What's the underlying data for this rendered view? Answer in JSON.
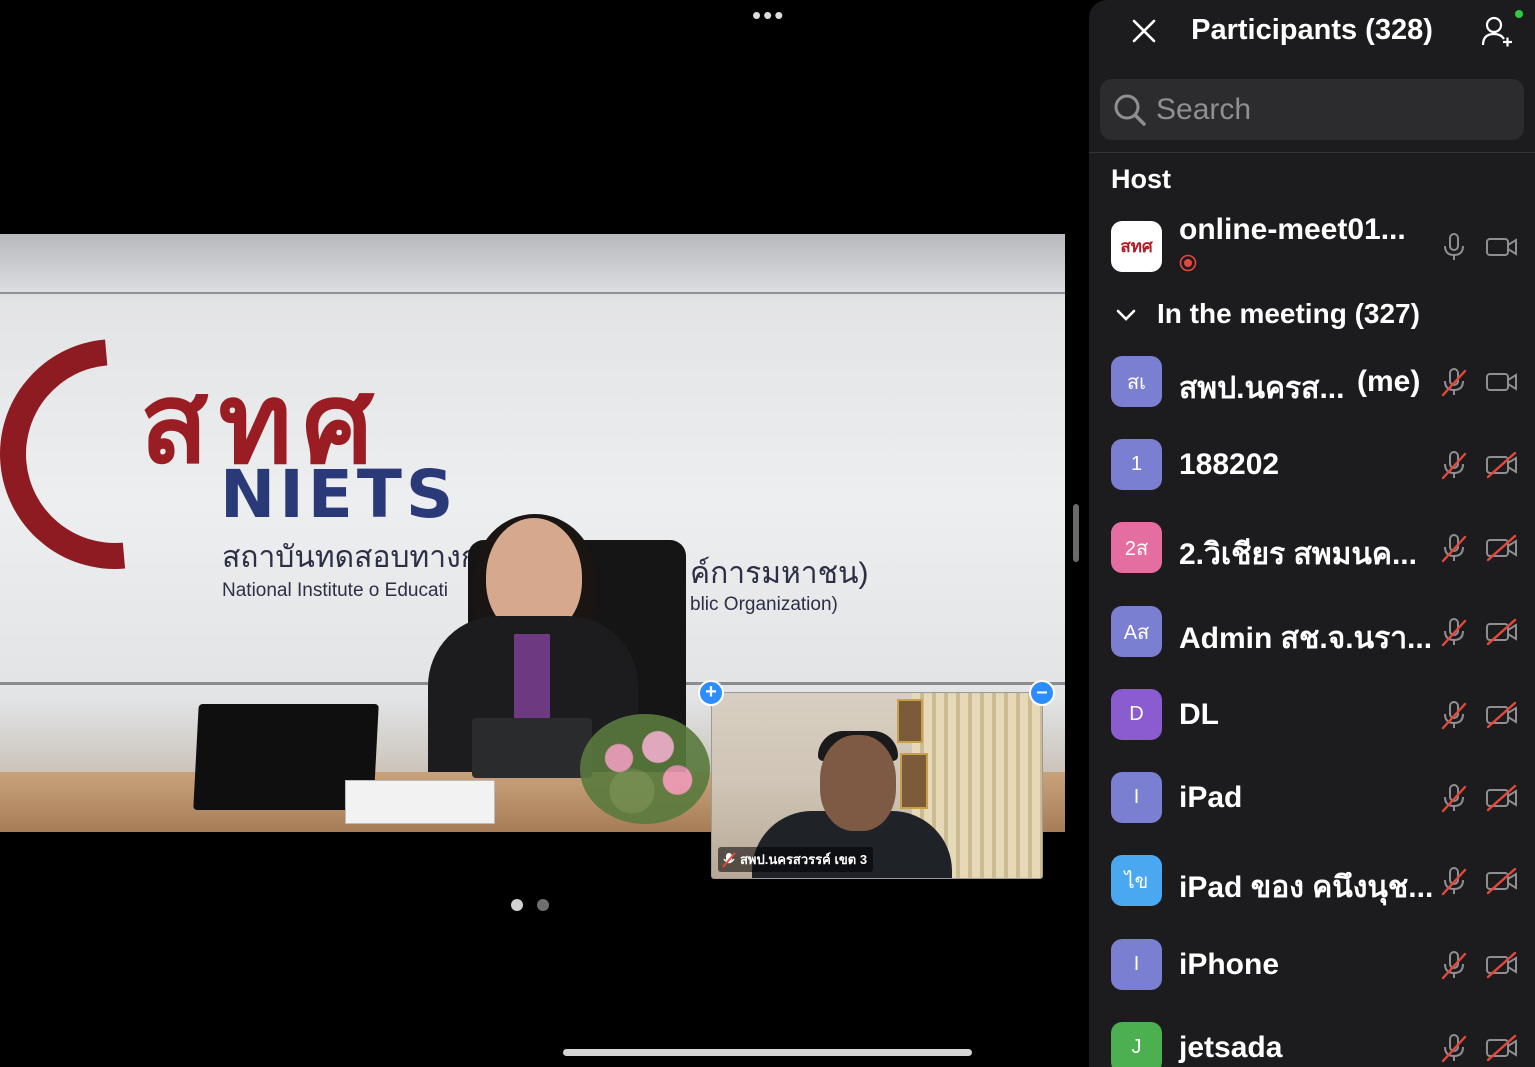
{
  "stage": {
    "logo_thai": "สทศ",
    "logo_niets": "NIETS",
    "logo_line1_left": "สถาบันทดสอบทางการ",
    "logo_line1_right": "ค์การมหาชน)",
    "logo_line2_left": "National  Institute  o  Educati",
    "logo_line2_right": "blic  Organization)",
    "pip_name": "สพป.นครสวรรค์ เขต 3"
  },
  "panel": {
    "title": "Participants (328)",
    "search_placeholder": "Search",
    "host_section": "Host",
    "host": {
      "name": "online-meet01...",
      "logo_text": "สทศ"
    },
    "group_label": "In the meeting (327)",
    "participants": [
      {
        "avatar": "สเ",
        "name": "สพป.นครส...",
        "me": "(me)",
        "color": "#7b7fd1",
        "mic_muted": true,
        "video_off": false
      },
      {
        "avatar": "1",
        "name": "188202",
        "me": "",
        "color": "#7b7fd1",
        "mic_muted": true,
        "video_off": true
      },
      {
        "avatar": "2ส",
        "name": "2.วิเชียร สพมนค...",
        "me": "",
        "color": "#e46ea0",
        "mic_muted": true,
        "video_off": true
      },
      {
        "avatar": "Aส",
        "name": "Admin สช.จ.นรา...",
        "me": "",
        "color": "#7b7fd1",
        "mic_muted": true,
        "video_off": true
      },
      {
        "avatar": "D",
        "name": "DL",
        "me": "",
        "color": "#8b5ccf",
        "mic_muted": true,
        "video_off": true
      },
      {
        "avatar": "I",
        "name": "iPad",
        "me": "",
        "color": "#7b7fd1",
        "mic_muted": true,
        "video_off": true
      },
      {
        "avatar": "ไข",
        "name": "iPad ของ คนึงนุช...",
        "me": "",
        "color": "#4aa8f0",
        "mic_muted": true,
        "video_off": true
      },
      {
        "avatar": "I",
        "name": "iPhone",
        "me": "",
        "color": "#7b7fd1",
        "mic_muted": true,
        "video_off": true
      },
      {
        "avatar": "J",
        "name": "jetsada",
        "me": "",
        "color": "#4cb050",
        "mic_muted": true,
        "video_off": true
      }
    ]
  },
  "icons": {
    "close": "close-icon",
    "invite": "add-person-icon",
    "search": "search-icon",
    "mic": "microphone-icon",
    "mic_muted": "microphone-muted-icon",
    "camera": "video-camera-icon",
    "camera_off": "video-camera-off-icon",
    "recording": "recording-icon",
    "chevron": "chevron-down-icon"
  },
  "colors": {
    "panel_bg": "#1c1c1e",
    "accent_blue": "#2d8cff",
    "muted_red": "#e5483b"
  }
}
